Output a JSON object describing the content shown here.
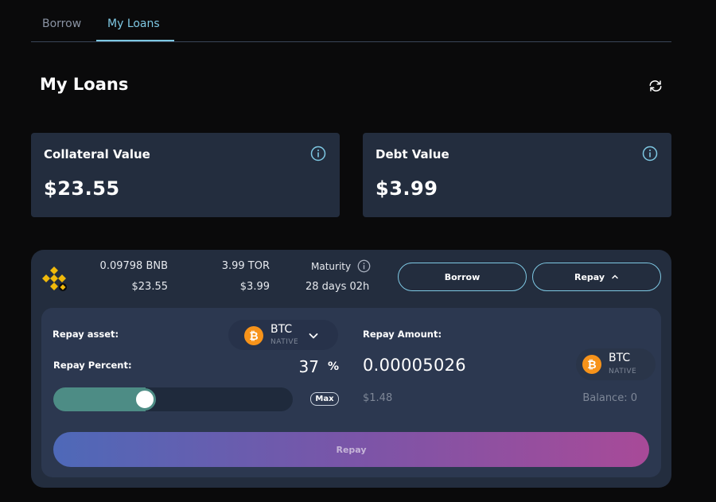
{
  "tabs": [
    {
      "label": "Borrow"
    },
    {
      "label": "My Loans"
    }
  ],
  "page": {
    "title": "My Loans"
  },
  "summary": {
    "collateral": {
      "label": "Collateral Value",
      "value": "$23.55"
    },
    "debt": {
      "label": "Debt Value",
      "value": "$3.99"
    }
  },
  "loan": {
    "collateral_amount": "0.09798 BNB",
    "collateral_usd": "$23.55",
    "debt_amount": "3.99 TOR",
    "debt_usd": "$3.99",
    "maturity_label": "Maturity",
    "maturity_value": "28 days 02h",
    "borrow_button": "Borrow",
    "repay_toggle_button": "Repay"
  },
  "repay": {
    "asset_label": "Repay asset:",
    "asset": {
      "symbol": "BTC",
      "sub": "NATIVE"
    },
    "percent_label": "Repay Percent:",
    "percent_value": "37",
    "percent_sign": "%",
    "percent_fraction": 0.37,
    "max_label": "Max",
    "amount_label": "Repay Amount:",
    "amount_value": "0.00005026",
    "amount_asset": {
      "symbol": "BTC",
      "sub": "NATIVE"
    },
    "usd_value": "$1.48",
    "balance": "Balance: 0",
    "submit_label": "Repay"
  },
  "colors": {
    "accent": "#7ec8e3",
    "panel": "#232d3e",
    "inner_panel": "#2c3850",
    "slider_fill": "#4d8c85",
    "btc": "#f7931a",
    "bnb": "#f0b90b"
  },
  "icons": [
    "refresh-icon",
    "info-icon",
    "bnb-icon",
    "btc-icon",
    "chevron-down-icon",
    "chevron-up-icon"
  ]
}
